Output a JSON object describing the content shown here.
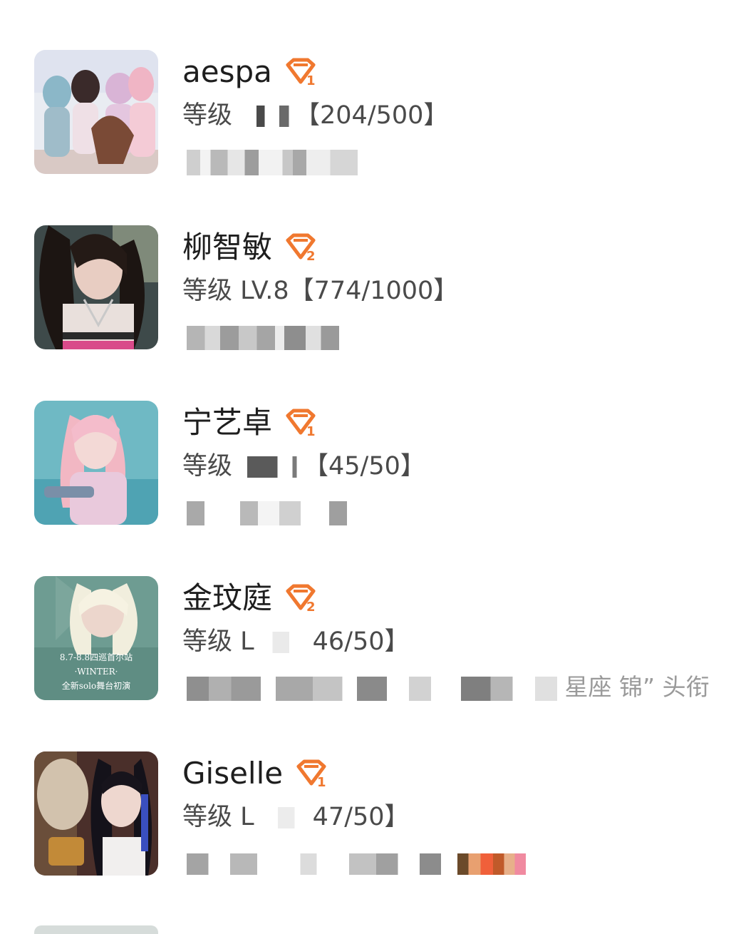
{
  "rows": [
    {
      "name": "aespa",
      "badge_icon": "diamond-badge-icon",
      "badge_digit": "1",
      "level_prefix": "等级",
      "level_value": "",
      "level_progress": "【204/500】",
      "desc_text": ""
    },
    {
      "name": "柳智敏",
      "badge_icon": "diamond-badge-icon",
      "badge_digit": "2",
      "level_prefix": "等级",
      "level_value": "LV.8",
      "level_progress": "【774/1000】",
      "desc_text": ""
    },
    {
      "name": "宁艺卓",
      "badge_icon": "diamond-badge-icon",
      "badge_digit": "1",
      "level_prefix": "等级",
      "level_value": "",
      "level_progress": "【45/50】",
      "desc_text": ""
    },
    {
      "name": "金玟庭",
      "badge_icon": "diamond-badge-icon",
      "badge_digit": "2",
      "level_prefix": "等级",
      "level_value": "L",
      "level_progress": "46/50】",
      "desc_text": "星座 锦” 头衔"
    },
    {
      "name": "Giselle",
      "badge_icon": "diamond-badge-icon",
      "badge_digit": "1",
      "level_prefix": "等级",
      "level_value": "L",
      "level_progress": "47/50】",
      "desc_text": ""
    }
  ],
  "avatar_texts": {
    "winter_line1": "8.7-8.8四巡首尔站",
    "winter_line2": "·WINTER·",
    "winter_line3": "全新solo舞台初演"
  },
  "colors": {
    "badge_orange": "#f0782f",
    "name_text": "#1e1e1e",
    "level_text": "#4a4a4a",
    "mosaic_gray": "#bdbdbd"
  }
}
